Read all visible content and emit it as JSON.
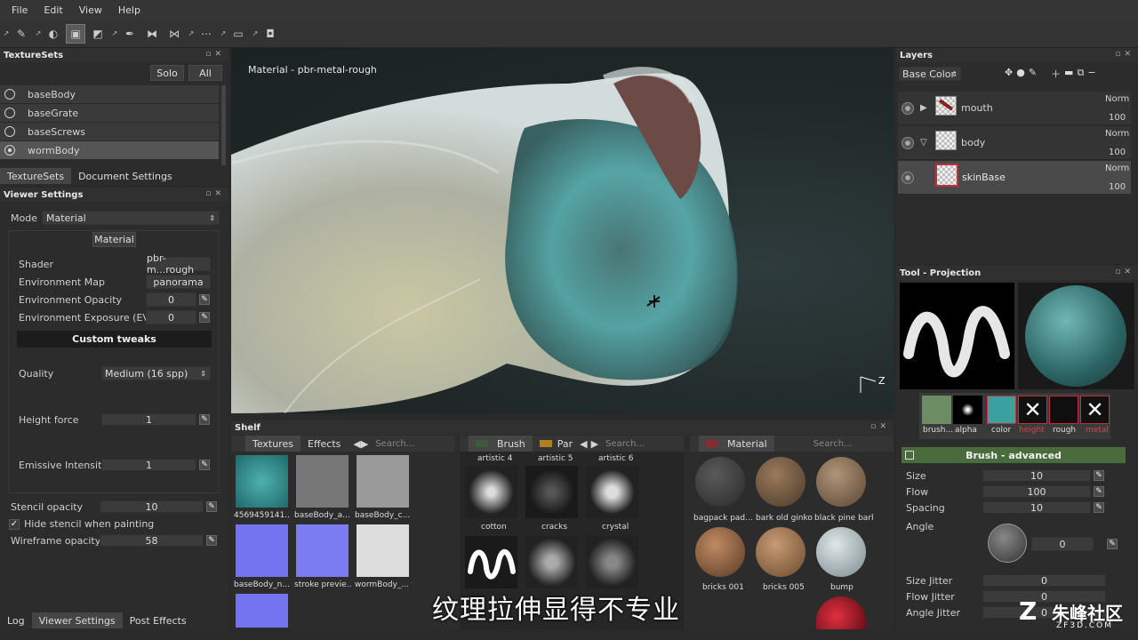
{
  "menu": [
    "File",
    "Edit",
    "View",
    "Help"
  ],
  "texturesets": {
    "title": "TextureSets",
    "solo_label": "Solo",
    "all_label": "All",
    "items": [
      "baseBody",
      "baseGrate",
      "baseScrews",
      "wormBody"
    ],
    "tabs": [
      "TextureSets",
      "Document Settings"
    ]
  },
  "viewer": {
    "title": "Viewer Settings",
    "mode_label": "Mode",
    "mode_value": "Material",
    "material_button": "Material",
    "shader_label": "Shader",
    "shader_value": "pbr-m...rough",
    "envmap_label": "Environment Map",
    "envmap_value": "panorama",
    "envop_label": "Environment Opacity",
    "envop_value": "0",
    "envexp_label": "Environment Exposure (EV)",
    "envexp_value": "0",
    "custom_tweaks": "Custom tweaks",
    "quality_label": "Quality",
    "quality_value": "Medium (16 spp)",
    "height_label": "Height force",
    "height_value": "1",
    "emissive_label": "Emissive Intensity",
    "emissive_value": "1",
    "stencil_label": "Stencil opacity",
    "stencil_value": "10",
    "hide_stencil_label": "Hide stencil when painting",
    "wire_label": "Wireframe opacity",
    "wire_value": "58"
  },
  "bottom_tabs": [
    "Log",
    "Viewer Settings",
    "Post Effects"
  ],
  "viewport": {
    "material_label": "Material - pbr-metal-rough",
    "axis_z": "Z"
  },
  "layers": {
    "title": "Layers",
    "channel": "Base Color",
    "items": [
      {
        "name": "mouth",
        "blend": "Norm",
        "opacity": "100"
      },
      {
        "name": "body",
        "blend": "Norm",
        "opacity": "100"
      },
      {
        "name": "skinBase",
        "blend": "Norm",
        "opacity": "100"
      }
    ]
  },
  "tool": {
    "title": "Tool - Projection",
    "channels": [
      "brush...",
      "alpha",
      "color",
      "height",
      "rough",
      "metal"
    ],
    "brush_adv": "Brush - advanced",
    "params": [
      {
        "label": "Size",
        "value": "10"
      },
      {
        "label": "Flow",
        "value": "100"
      },
      {
        "label": "Spacing",
        "value": "10"
      }
    ],
    "angle_label": "Angle",
    "angle_value": "0",
    "jitters": [
      {
        "label": "Size Jitter",
        "value": "0"
      },
      {
        "label": "Flow Jitter",
        "value": "0"
      },
      {
        "label": "Angle Jitter",
        "value": "0"
      }
    ]
  },
  "shelf": {
    "title": "Shelf",
    "tabs1": [
      "Textures",
      "Effects"
    ],
    "search": "Search...",
    "tex_captions": [
      "4569459141...",
      "baseBody_a...",
      "baseBody_c...",
      "baseBody_n...",
      "stroke previe...",
      "wormBody_..."
    ],
    "brush_tab": "Brush",
    "par_tab": "Par",
    "brush_top": [
      "artistic 4",
      "artistic 5",
      "artistic 6"
    ],
    "brush_captions": [
      "cotton",
      "cracks",
      "crystal"
    ],
    "material_tab": "Material",
    "mat_captions": [
      "bagpack pad...",
      "bark old ginko",
      "black pine bark",
      "bricks 001",
      "bricks 005",
      "bump"
    ]
  },
  "subtitle": "纹理拉伸显得不专业",
  "watermark": "朱峰社区",
  "watermark_url": "ZF3D.COM"
}
